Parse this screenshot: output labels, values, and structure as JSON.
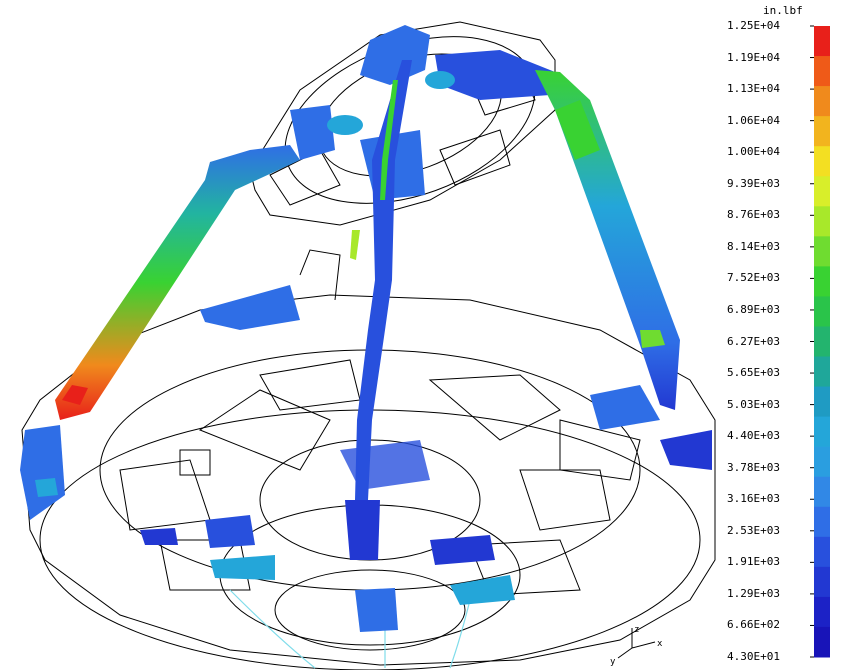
{
  "legend": {
    "unit": "in.lbf",
    "labels": [
      "1.25E+04",
      "1.19E+04",
      "1.13E+04",
      "1.06E+04",
      "1.00E+04",
      "9.39E+03",
      "8.76E+03",
      "8.14E+03",
      "7.52E+03",
      "6.89E+03",
      "6.27E+03",
      "5.65E+03",
      "5.03E+03",
      "4.40E+03",
      "3.78E+03",
      "3.16E+03",
      "2.53E+03",
      "1.91E+03",
      "1.29E+03",
      "6.66E+02",
      "4.30E+01"
    ],
    "colors": [
      "#e8201a",
      "#ef5a18",
      "#f08a1c",
      "#f2b41e",
      "#f3df22",
      "#d8ee2a",
      "#a8e82a",
      "#6fdc30",
      "#39d232",
      "#2ac44a",
      "#23b46e",
      "#1fa79a",
      "#1f9bc3",
      "#24a6d9",
      "#2a9ee0",
      "#3188e6",
      "#2f6ee6",
      "#2850dd",
      "#2238d2",
      "#1c22c6",
      "#1814b8"
    ]
  },
  "triad": {
    "x": "x",
    "y": "y",
    "z": "z"
  }
}
